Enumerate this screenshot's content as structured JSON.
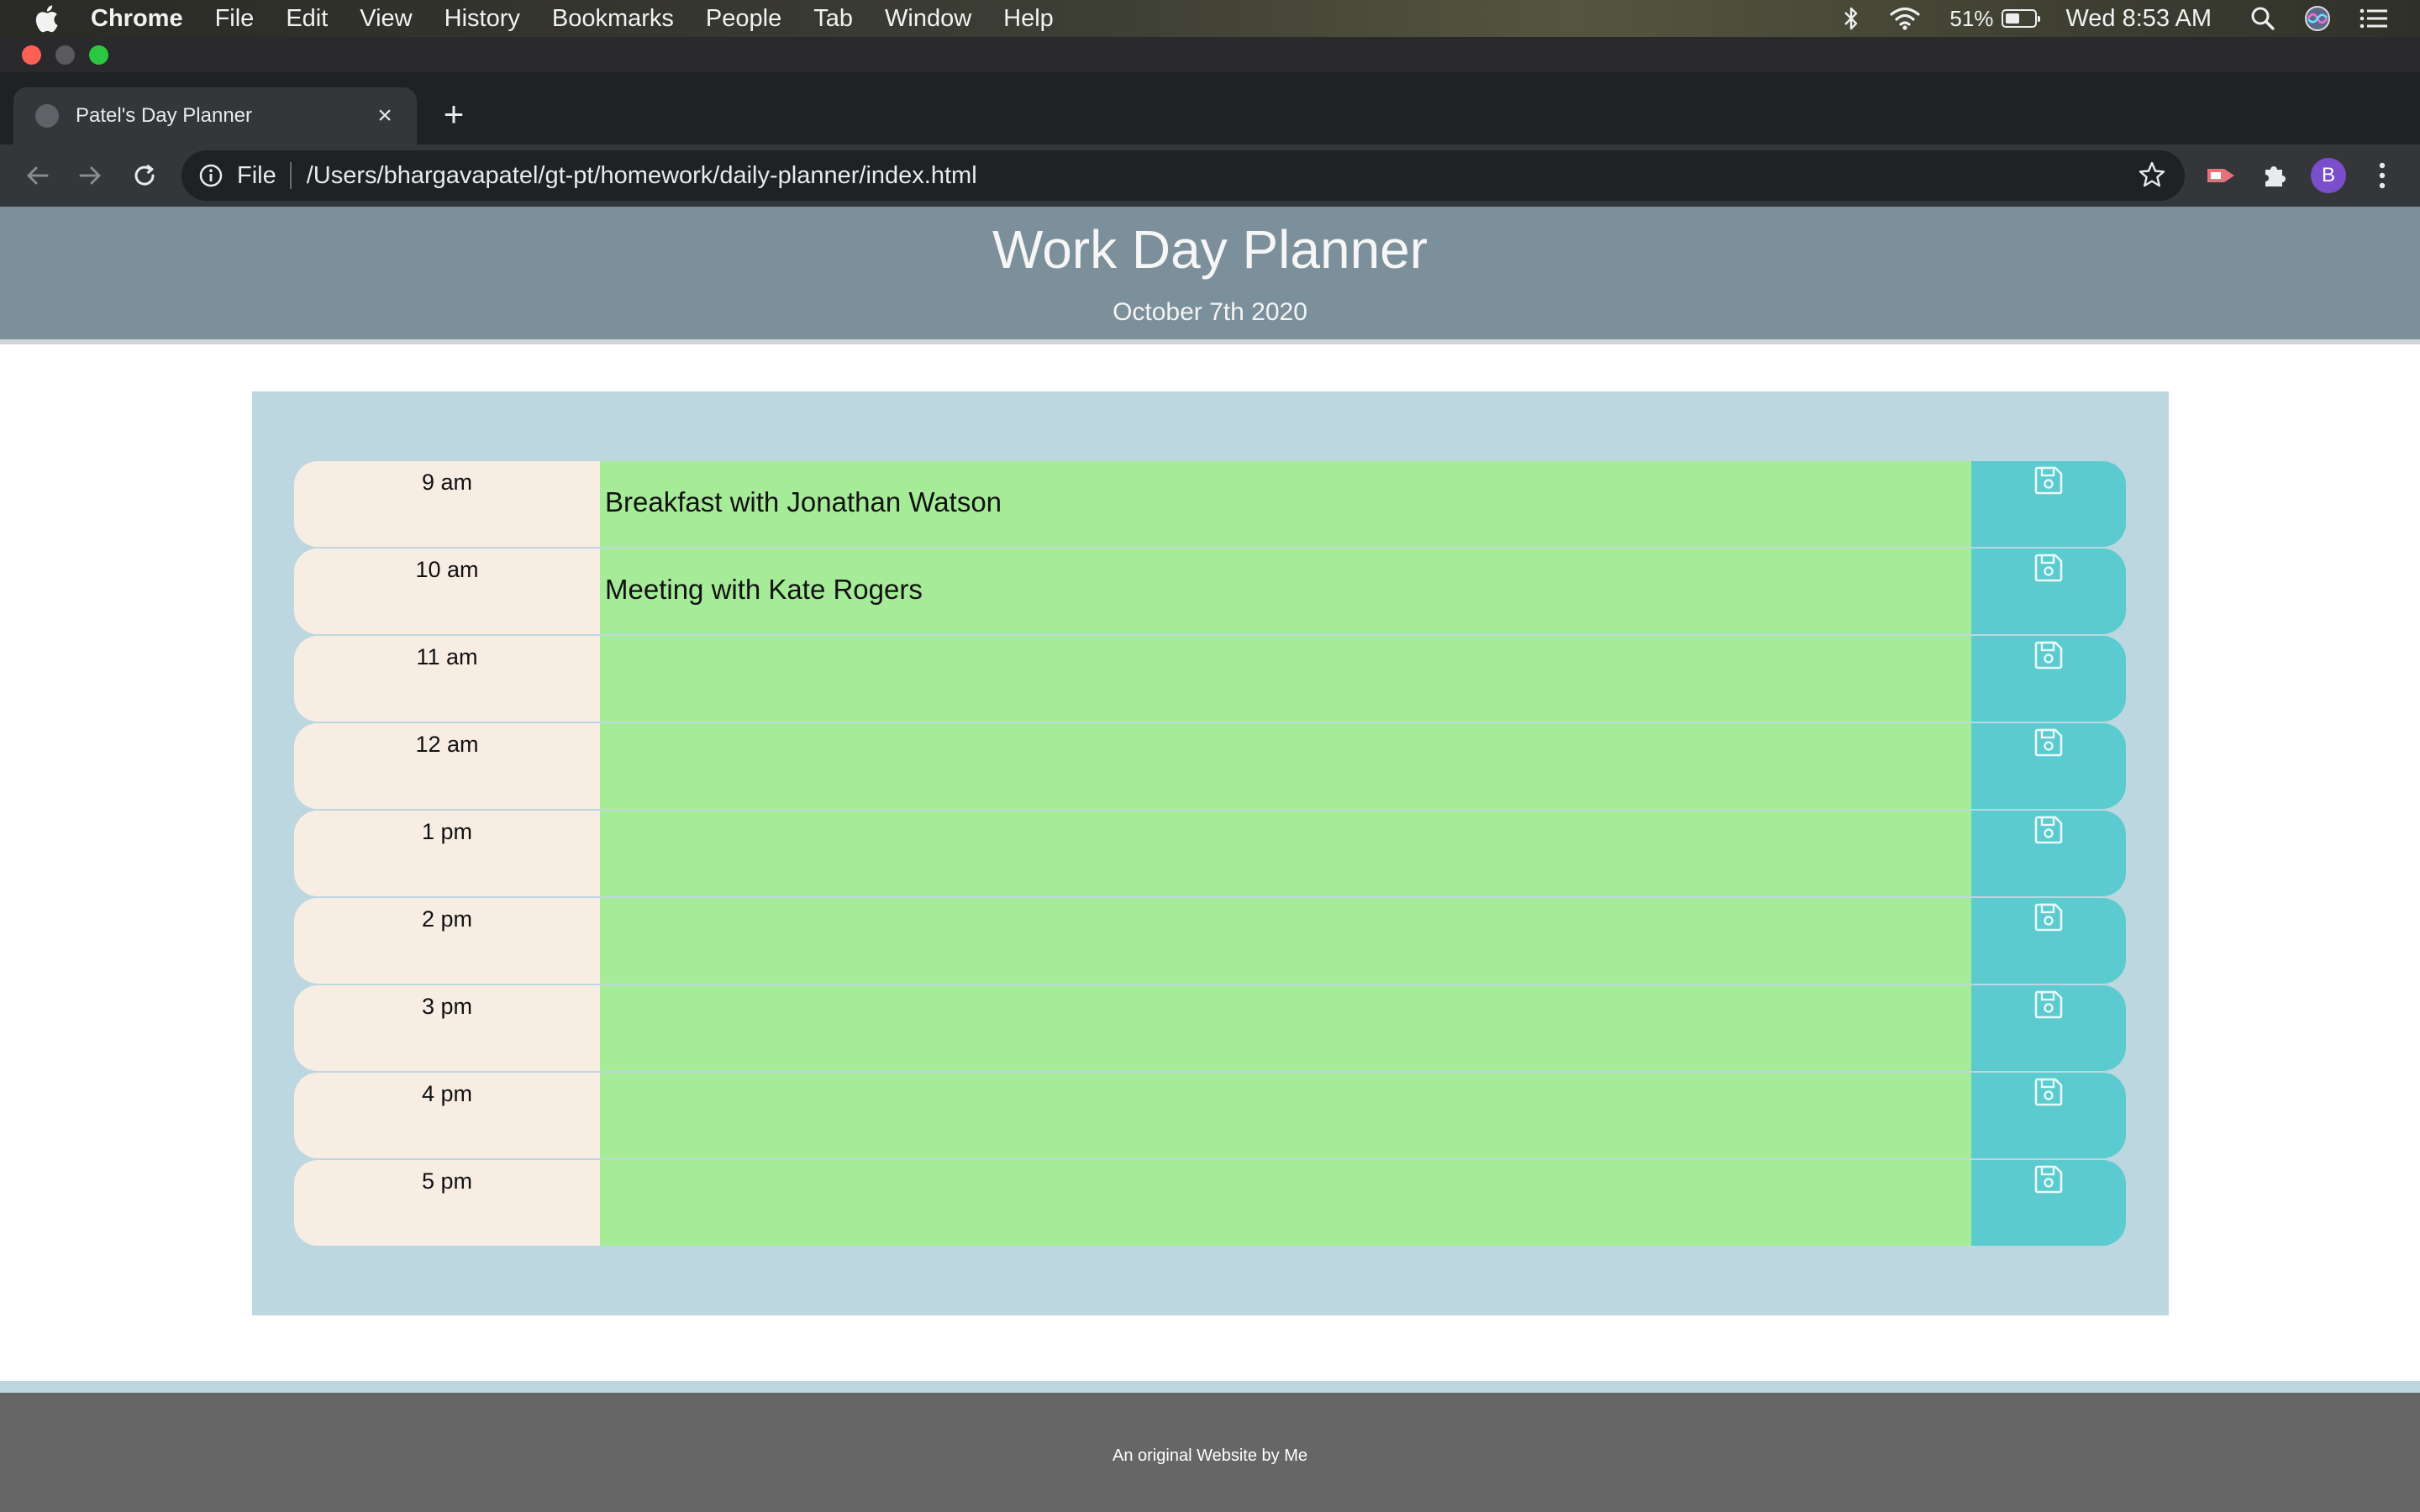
{
  "menubar": {
    "app_name": "Chrome",
    "items": [
      "File",
      "Edit",
      "View",
      "History",
      "Bookmarks",
      "People",
      "Tab",
      "Window",
      "Help"
    ],
    "battery": "51%",
    "battery_level": 0.51,
    "clock": "Wed 8:53 AM"
  },
  "browser": {
    "tab_title": "Patel's Day Planner",
    "url_scheme": "File",
    "url_path": "/Users/bhargavapatel/gt-pt/homework/daily-planner/index.html",
    "profile_initial": "B"
  },
  "page": {
    "title": "Work Day Planner",
    "date": "October 7th 2020",
    "footer": "An original Website by Me"
  },
  "planner": [
    {
      "hour": "9 am",
      "text": "Breakfast with Jonathan Watson"
    },
    {
      "hour": "10 am",
      "text": "Meeting with Kate Rogers"
    },
    {
      "hour": "11 am",
      "text": ""
    },
    {
      "hour": "12 am",
      "text": ""
    },
    {
      "hour": "1 pm",
      "text": ""
    },
    {
      "hour": "2 pm",
      "text": ""
    },
    {
      "hour": "3 pm",
      "text": ""
    },
    {
      "hour": "4 pm",
      "text": ""
    },
    {
      "hour": "5 pm",
      "text": ""
    }
  ],
  "colors": {
    "header": "#7b909b",
    "container": "#bdd7e0",
    "hour_column": "#f7ede3",
    "future_row": "#a6ec98",
    "save_button": "#5bcbcf",
    "footer": "#666666"
  },
  "icons": {
    "save": "floppy-disk-icon"
  }
}
